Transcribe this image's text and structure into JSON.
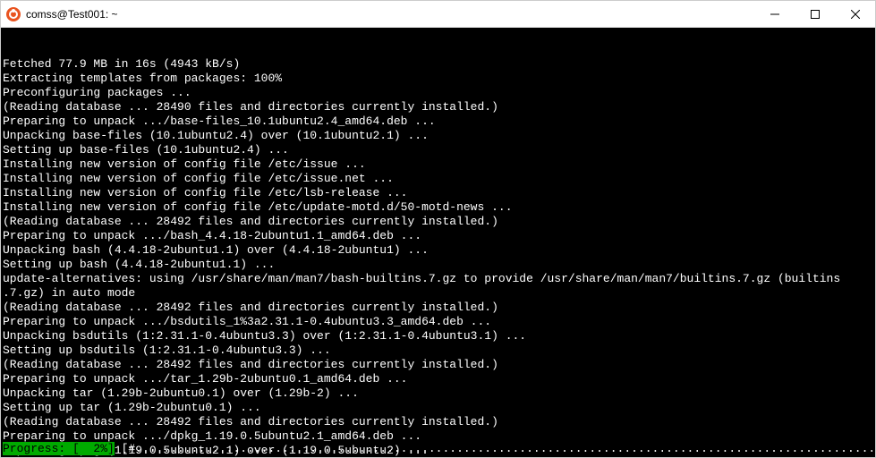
{
  "window": {
    "title": "comss@Test001: ~"
  },
  "terminal": {
    "lines": [
      "Fetched 77.9 MB in 16s (4943 kB/s)",
      "Extracting templates from packages: 100%",
      "Preconfiguring packages ...",
      "(Reading database ... 28490 files and directories currently installed.)",
      "Preparing to unpack .../base-files_10.1ubuntu2.4_amd64.deb ...",
      "Unpacking base-files (10.1ubuntu2.4) over (10.1ubuntu2.1) ...",
      "Setting up base-files (10.1ubuntu2.4) ...",
      "Installing new version of config file /etc/issue ...",
      "Installing new version of config file /etc/issue.net ...",
      "Installing new version of config file /etc/lsb-release ...",
      "Installing new version of config file /etc/update-motd.d/50-motd-news ...",
      "(Reading database ... 28492 files and directories currently installed.)",
      "Preparing to unpack .../bash_4.4.18-2ubuntu1.1_amd64.deb ...",
      "Unpacking bash (4.4.18-2ubuntu1.1) over (4.4.18-2ubuntu1) ...",
      "Setting up bash (4.4.18-2ubuntu1.1) ...",
      "update-alternatives: using /usr/share/man/man7/bash-builtins.7.gz to provide /usr/share/man/man7/builtins.7.gz (builtins",
      ".7.gz) in auto mode",
      "(Reading database ... 28492 files and directories currently installed.)",
      "Preparing to unpack .../bsdutils_1%3a2.31.1-0.4ubuntu3.3_amd64.deb ...",
      "Unpacking bsdutils (1:2.31.1-0.4ubuntu3.3) over (1:2.31.1-0.4ubuntu3.1) ...",
      "Setting up bsdutils (1:2.31.1-0.4ubuntu3.3) ...",
      "(Reading database ... 28492 files and directories currently installed.)",
      "Preparing to unpack .../tar_1.29b-2ubuntu0.1_amd64.deb ...",
      "Unpacking tar (1.29b-2ubuntu0.1) over (1.29b-2) ...",
      "Setting up tar (1.29b-2ubuntu0.1) ...",
      "(Reading database ... 28492 files and directories currently installed.)",
      "Preparing to unpack .../dpkg_1.19.0.5ubuntu2.1_amd64.deb ...",
      "Unpacking dpkg (1.19.0.5ubuntu2.1) over (1.19.0.5ubuntu2) ..."
    ],
    "progress": {
      "label": "Progress: [  2%]",
      "bar": " [#..........................................................................................................................] "
    }
  }
}
